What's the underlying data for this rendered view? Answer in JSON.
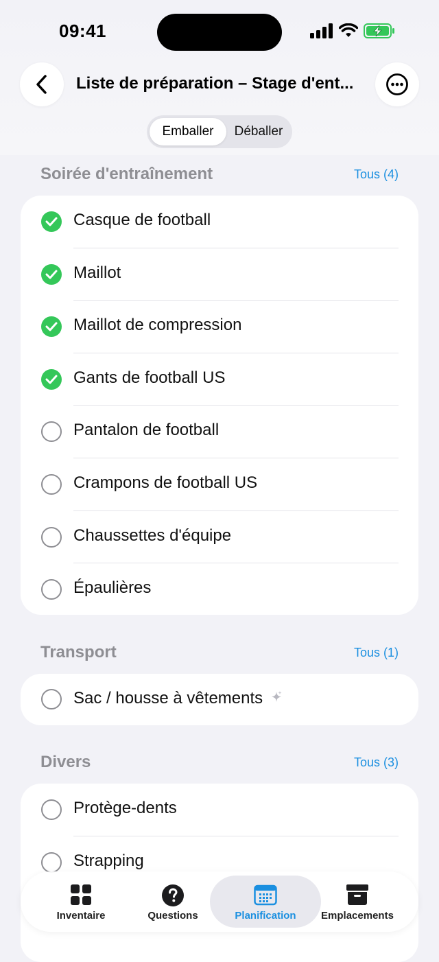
{
  "status_bar": {
    "time": "09:41"
  },
  "nav": {
    "title": "Liste de préparation – Stage d'ent..."
  },
  "segmented": {
    "active": "Emballer",
    "inactive": "Déballer"
  },
  "sections": [
    {
      "title": "Soirée d'entraînement",
      "link": "Tous (4)",
      "items": [
        {
          "label": "Casque de football",
          "checked": true
        },
        {
          "label": "Maillot",
          "checked": true
        },
        {
          "label": "Maillot de compression",
          "checked": true
        },
        {
          "label": "Gants de football US",
          "checked": true
        },
        {
          "label": "Pantalon de football",
          "checked": false
        },
        {
          "label": "Crampons de football US",
          "checked": false
        },
        {
          "label": "Chaussettes d'équipe",
          "checked": false
        },
        {
          "label": "Épaulières",
          "checked": false
        }
      ]
    },
    {
      "title": "Transport",
      "link": "Tous (1)",
      "items": [
        {
          "label": "Sac / housse à vêtements",
          "checked": false,
          "sparkle": true
        }
      ]
    },
    {
      "title": "Divers",
      "link": "Tous (3)",
      "items": [
        {
          "label": "Protège-dents",
          "checked": false
        },
        {
          "label": "Strapping",
          "checked": false
        }
      ]
    }
  ],
  "tabbar": {
    "tabs": [
      {
        "label": "Inventaire",
        "icon": "grid-icon"
      },
      {
        "label": "Questions",
        "icon": "question-circle-icon"
      },
      {
        "label": "Planification",
        "icon": "calendar-icon",
        "active": true
      },
      {
        "label": "Emplacements",
        "icon": "archive-box-icon"
      }
    ]
  },
  "colors": {
    "accent": "#1a8fe0",
    "check": "#34c759",
    "background": "#f2f2f7"
  }
}
